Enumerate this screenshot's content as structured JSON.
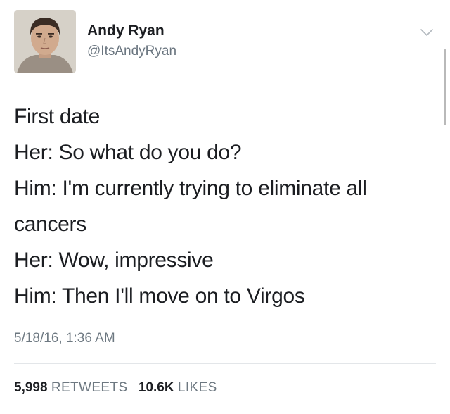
{
  "author": {
    "display_name": "Andy Ryan",
    "handle": "@ItsAndyRyan",
    "avatar_icon": "user-avatar-photo"
  },
  "menu_icon": "chevron-down-icon",
  "tweet": {
    "lines": [
      "First date",
      "Her: So what do you do?",
      "Him: I'm currently trying to eliminate all",
      "cancers",
      "Her: Wow, impressive",
      "Him: Then I'll move on to Virgos"
    ],
    "timestamp": "5/18/16, 1:36 AM"
  },
  "stats": {
    "retweets_count": "5,998",
    "retweets_label": "RETWEETS",
    "likes_count": "10.6K",
    "likes_label": "LIKES"
  },
  "colors": {
    "text": "#1b1d21",
    "secondary_text": "#6d7881",
    "divider": "#e3e6e9"
  }
}
